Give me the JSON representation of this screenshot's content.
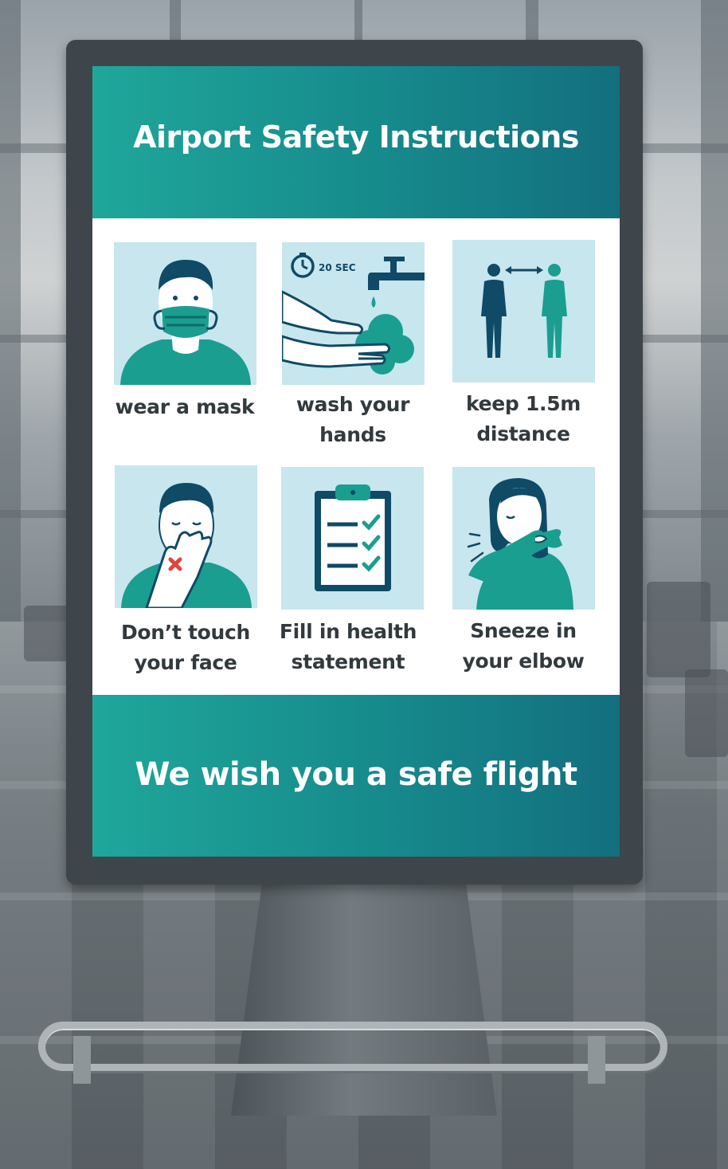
{
  "sign": {
    "title": "Airport Safety Instructions",
    "footer": "We wish you a safe flight",
    "colors": {
      "teal_light": "#1fa79a",
      "teal_dark": "#136f7e",
      "tile_bg": "#c7e6ee",
      "figure_teal": "#1a9e90",
      "figure_navy": "#0f4a66",
      "warning_red": "#e0453b"
    },
    "instructions": [
      {
        "icon": "face-mask-icon",
        "line1": "wear a mask",
        "line2": ""
      },
      {
        "icon": "hand-washing-icon",
        "timer_label": "20 SEC",
        "line1": "wash your",
        "line2": "hands"
      },
      {
        "icon": "social-distance-icon",
        "line1": "keep 1.5m",
        "line2": "distance"
      },
      {
        "icon": "no-face-touch-icon",
        "line1": "Don’t touch",
        "line2": "your face"
      },
      {
        "icon": "health-checklist-icon",
        "line1": "Fill in health",
        "line2": "statement"
      },
      {
        "icon": "sneeze-elbow-icon",
        "line1": "Sneeze in",
        "line2": "your elbow"
      }
    ]
  }
}
